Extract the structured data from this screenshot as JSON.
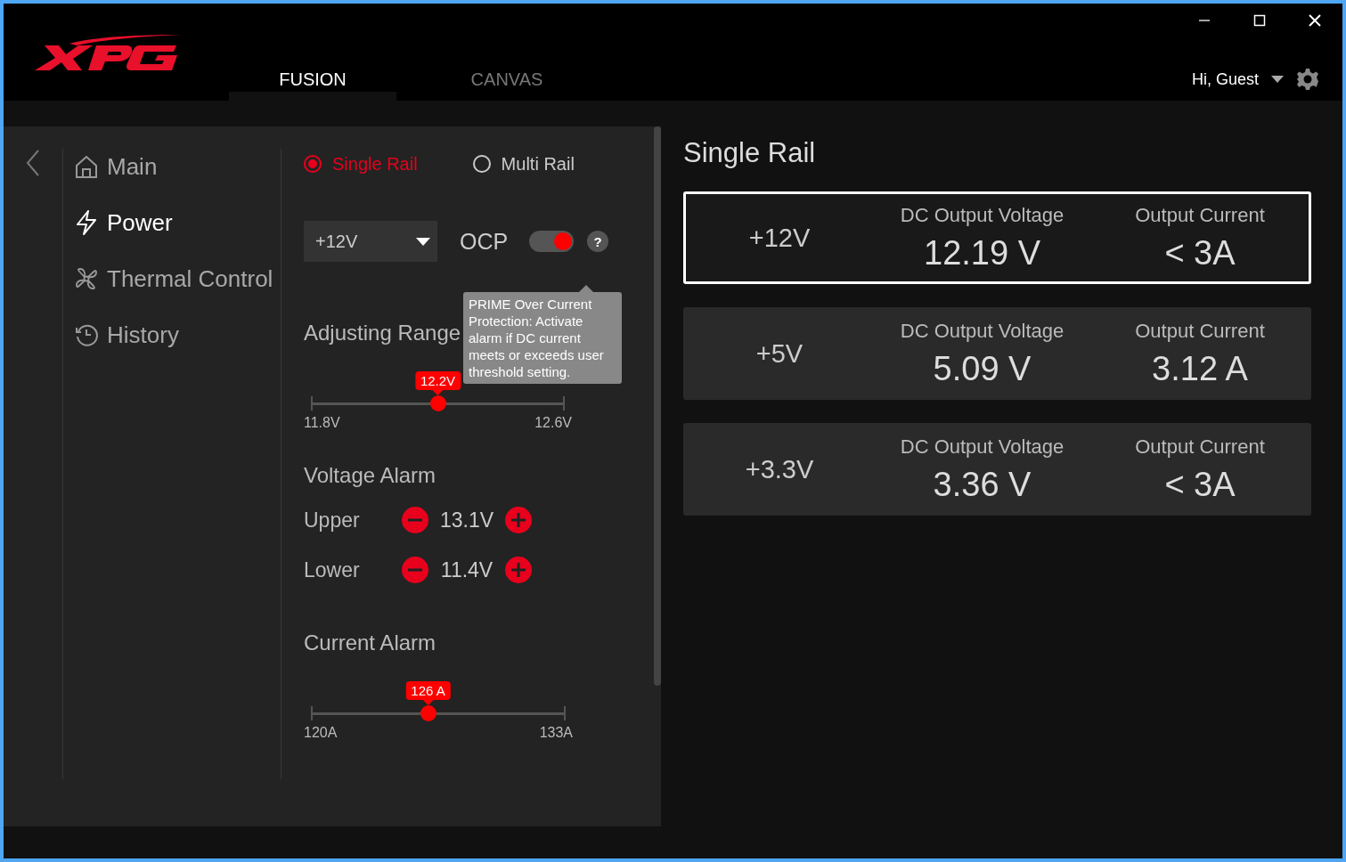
{
  "header": {
    "tabs": [
      {
        "label": "FUSION",
        "selected": true
      },
      {
        "label": "CANVAS",
        "selected": false
      }
    ],
    "greeting": "Hi, Guest"
  },
  "sidebar": {
    "items": [
      {
        "label": "Main",
        "selected": false
      },
      {
        "label": "Power",
        "selected": true
      },
      {
        "label": "Thermal Control",
        "selected": false
      },
      {
        "label": "History",
        "selected": false
      }
    ]
  },
  "rail_modes": [
    {
      "label": "Single Rail",
      "selected": true
    },
    {
      "label": "Multi Rail",
      "selected": false
    }
  ],
  "rail_select": {
    "value": "+12V"
  },
  "ocp": {
    "label": "OCP",
    "on": true,
    "help": "?",
    "tooltip": "PRIME Over Current Protection: Activate alarm if DC current meets or exceeds user threshold setting."
  },
  "adjusting_range": {
    "title": "Adjusting Range",
    "value": "12.2V",
    "level": 0.5,
    "min": "11.8V",
    "max": "12.6V"
  },
  "voltage_alarm": {
    "title": "Voltage Alarm",
    "rows": [
      {
        "label": "Upper",
        "value": "13.1V"
      },
      {
        "label": "Lower",
        "value": "11.4V"
      }
    ]
  },
  "current_alarm": {
    "title": "Current Alarm",
    "value": "126 A",
    "level": 0.46,
    "min": "120A",
    "max": "133A"
  },
  "output": {
    "title": "Single Rail",
    "rails": [
      {
        "name": "+12V",
        "selected": true,
        "voltage_label": "DC Output Voltage",
        "voltage": "12.19 V",
        "current_label": "Output Current",
        "current": "< 3A"
      },
      {
        "name": "+5V",
        "selected": false,
        "voltage_label": "DC Output Voltage",
        "voltage": "5.09 V",
        "current_label": "Output Current",
        "current": "3.12 A"
      },
      {
        "name": "+3.3V",
        "selected": false,
        "voltage_label": "DC Output Voltage",
        "voltage": "3.36 V",
        "current_label": "Output Current",
        "current": "< 3A"
      }
    ]
  }
}
